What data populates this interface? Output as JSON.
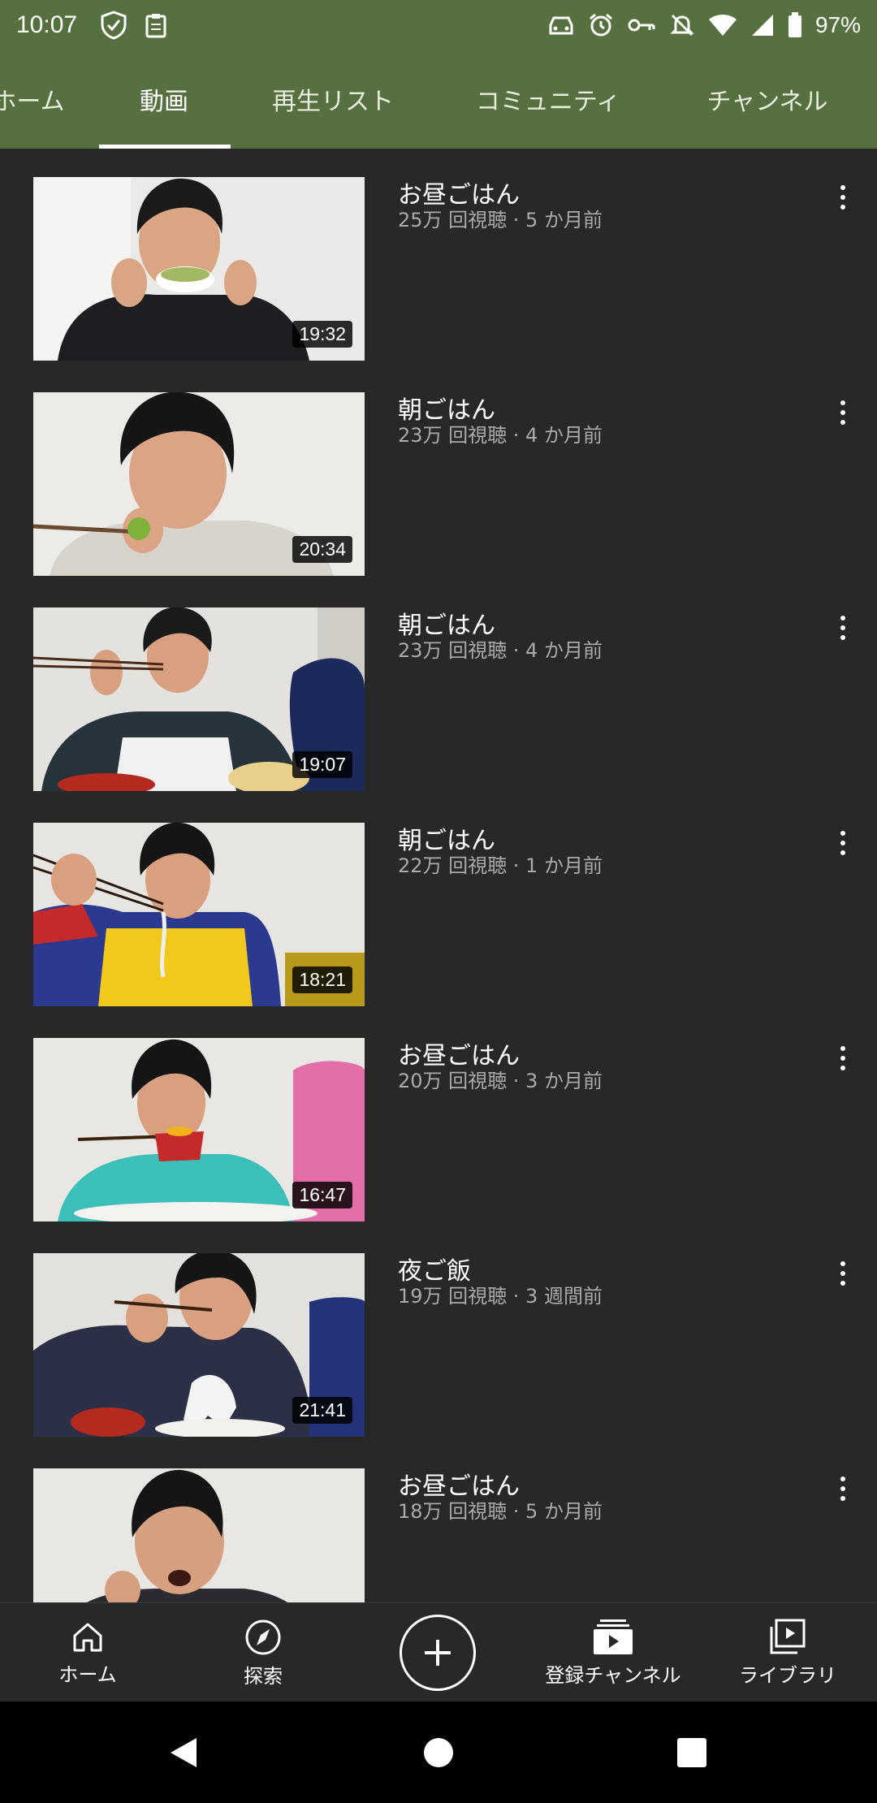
{
  "status_bar": {
    "time": "10:07",
    "battery": "97%",
    "left_icons": [
      "shield-check-icon",
      "clipboard-icon"
    ],
    "right_icons": [
      "car-icon",
      "alarm-icon",
      "key-icon",
      "notifications-off-icon",
      "wifi-icon",
      "signal-icon",
      "battery-icon"
    ]
  },
  "tabs": [
    {
      "label": "ホーム",
      "active": false
    },
    {
      "label": "動画",
      "active": true
    },
    {
      "label": "再生リスト",
      "active": false
    },
    {
      "label": "コミュニティ",
      "active": false
    },
    {
      "label": "チャンネル",
      "active": false
    }
  ],
  "videos": [
    {
      "title": "お昼ごはん",
      "meta": "25万 回視聴 · 5 か月前",
      "duration": "19:32"
    },
    {
      "title": "朝ごはん",
      "meta": "23万 回視聴 · 4 か月前",
      "duration": "20:34"
    },
    {
      "title": "朝ごはん",
      "meta": "23万 回視聴 · 4 か月前",
      "duration": "19:07"
    },
    {
      "title": "朝ごはん",
      "meta": "22万 回視聴 · 1 か月前",
      "duration": "18:21"
    },
    {
      "title": "お昼ごはん",
      "meta": "20万 回視聴 · 3 か月前",
      "duration": "16:47"
    },
    {
      "title": "夜ご飯",
      "meta": "19万 回視聴 · 3 週間前",
      "duration": "21:41"
    },
    {
      "title": "お昼ごはん",
      "meta": "18万 回視聴 · 5 か月前",
      "duration": ""
    }
  ],
  "bottom_nav": {
    "home": "ホーム",
    "explore": "探索",
    "subscriptions": "登録チャンネル",
    "library": "ライブラリ"
  },
  "colors": {
    "header_green": "#56713f",
    "background": "#282828",
    "meta_gray": "#aaaaaa"
  }
}
